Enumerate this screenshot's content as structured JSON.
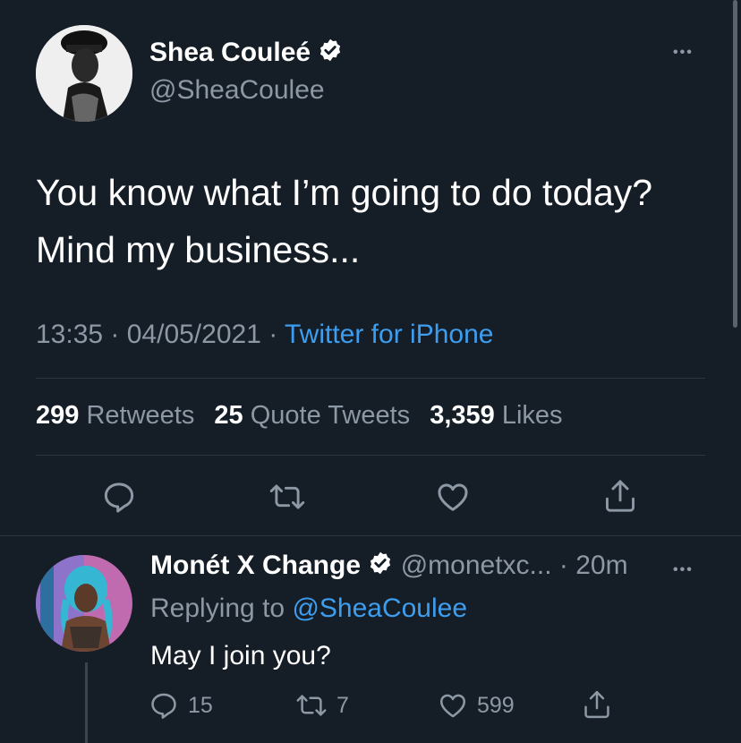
{
  "tweet": {
    "author_name": "Shea Couleé",
    "author_handle": "@SheaCoulee",
    "text_line1": "You know what I’m going to do today?",
    "text_line2": "Mind my business...",
    "time": "13:35 · 04/05/2021 · ",
    "source": "Twitter for iPhone",
    "stats": {
      "retweets_count": "299",
      "retweets_label": "Retweets",
      "quotes_count": "25",
      "quotes_label": "Quote Tweets",
      "likes_count": "3,359",
      "likes_label": "Likes"
    },
    "more": "•••"
  },
  "reply": {
    "author_name": "Monét X Change",
    "author_handle": "@monetxc...",
    "time": "· 20m",
    "replying_prefix": "Replying to ",
    "replying_handle": "@SheaCoulee",
    "text": "May I join you?",
    "reply_count": "15",
    "retweet_count": "7",
    "like_count": "599",
    "more": "•••"
  },
  "colors": {
    "background": "#151d27",
    "accent": "#3d9ef0",
    "muted": "#8d98a5"
  }
}
